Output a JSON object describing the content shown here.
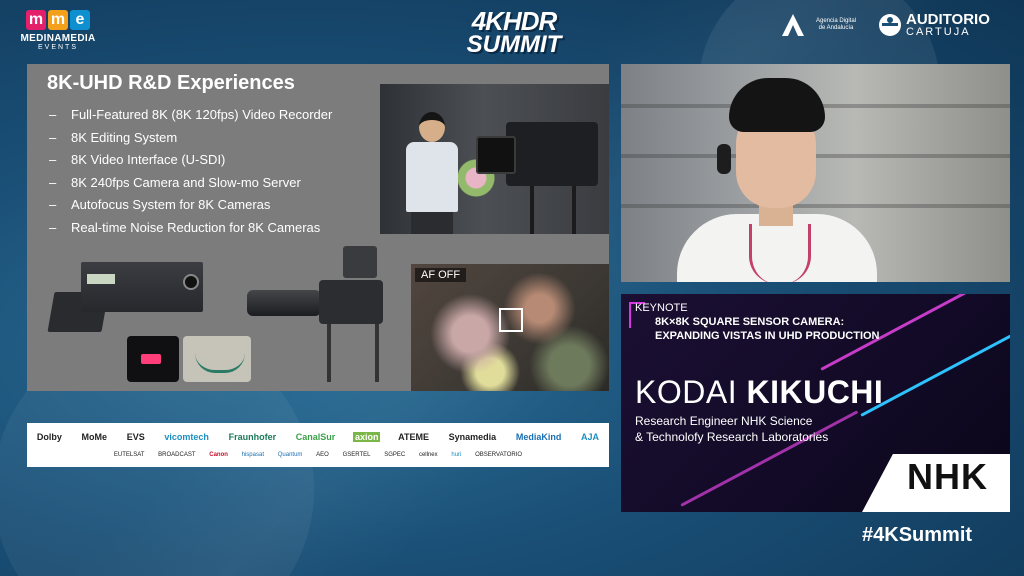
{
  "header": {
    "mme_logo": {
      "letters": [
        "m",
        "m",
        "e"
      ],
      "colors": [
        "#e4206b",
        "#f4a01a",
        "#0d8fd0"
      ],
      "name": "MEDINAMEDIA",
      "sub": "EVENTS"
    },
    "summit_logo": {
      "line1": "4KHDR",
      "line2": "SUMMIT"
    },
    "andalucia_logo": {
      "text": "Agencia Digital de Andalucía"
    },
    "auditorio_logo": {
      "line1": "AUDITORIO",
      "line2": "CARTUJA"
    }
  },
  "slide": {
    "title": "8K-UHD R&D Experiences",
    "bullet_marker": "–",
    "bullets": [
      "Full-Featured 8K (8K 120fps) Video Recorder",
      "8K Editing System",
      "8K Video Interface (U-SDI)",
      "8K 240fps Camera and Slow-mo Server",
      "Autofocus System for 8K Cameras",
      "Real-time Noise Reduction for 8K Cameras"
    ],
    "af_label": "AF OFF"
  },
  "sponsors": {
    "row1": [
      "Dolby",
      "MoMe",
      "EVS",
      "vicomtech",
      "Fraunhofer",
      "CanalSur",
      "axion",
      "ATEME",
      "Synamedia",
      "MediaKind",
      "AJA"
    ],
    "row2": [
      "EUTELSAT",
      "BROADCAST",
      "",
      "Canon",
      "hispasat",
      "Quantum",
      "AEO",
      "GSERTEL",
      "SGPEC",
      "",
      "cellnex",
      "huri",
      "OBSERVATORIO"
    ]
  },
  "keynote": {
    "label": "KEYNOTE",
    "title_line1": "8K×8K SQUARE SENSOR CAMERA:",
    "title_line2": "EXPANDING VISTAS IN UHD PRODUCTION",
    "first_name": "KODAI",
    "last_name": "KIKUCHI",
    "role_line1": "Research Engineer NHK Science",
    "role_line2": "& Technolofy Research Laboratories",
    "org_logo": "NHK"
  },
  "hashtag": "#4KSummit"
}
